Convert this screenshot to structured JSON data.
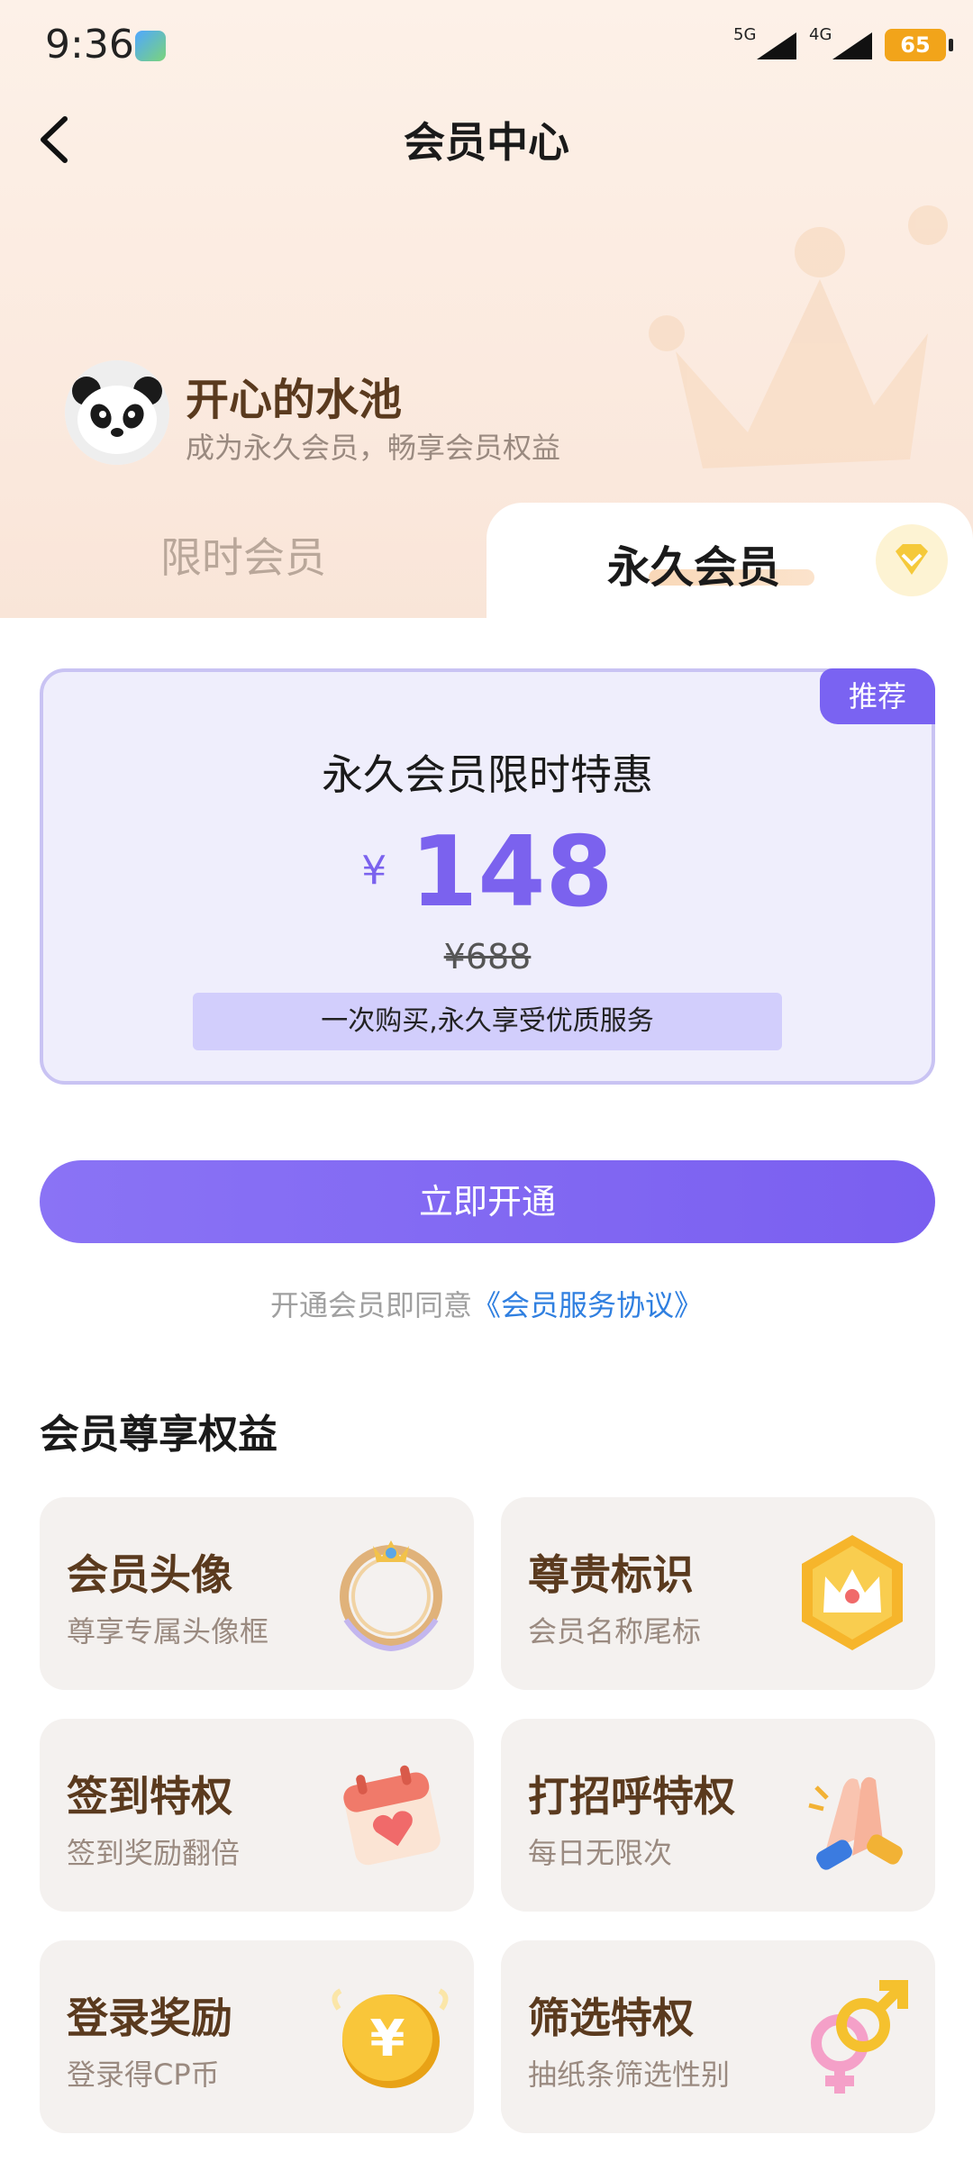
{
  "status_bar": {
    "time": "9:36",
    "signal_1_label": "5G",
    "signal_2_label": "4G",
    "battery": "65"
  },
  "nav": {
    "title": "会员中心",
    "back_icon": "chevron-left-icon"
  },
  "profile": {
    "username": "开心的水池",
    "subtitle": "成为永久会员，畅享会员权益",
    "avatar_icon": "panda-avatar"
  },
  "tabs": [
    {
      "label": "限时会员",
      "selected": false
    },
    {
      "label": "永久会员",
      "selected": true
    }
  ],
  "offer": {
    "badge": "推荐",
    "title": "永久会员限时特惠",
    "currency": "¥",
    "price": "148",
    "original_price": "¥688",
    "note": "一次购买,永久享受优质服务"
  },
  "cta": {
    "label": "立即开通"
  },
  "agreement": {
    "prefix": "开通会员即同意",
    "link": "《会员服务协议》"
  },
  "benefits": {
    "title": "会员尊享权益",
    "items": [
      {
        "name": "会员头像",
        "desc": "尊享专属头像框",
        "icon": "avatar-frame-icon"
      },
      {
        "name": "尊贵标识",
        "desc": "会员名称尾标",
        "icon": "crown-badge-icon"
      },
      {
        "name": "签到特权",
        "desc": "签到奖励翻倍",
        "icon": "calendar-heart-icon"
      },
      {
        "name": "打招呼特权",
        "desc": "每日无限次",
        "icon": "clapping-hands-icon"
      },
      {
        "name": "登录奖励",
        "desc": "登录得CP币",
        "icon": "yuan-coin-icon"
      },
      {
        "name": "筛选特权",
        "desc": "抽纸条筛选性别",
        "icon": "gender-symbols-icon"
      }
    ]
  },
  "colors": {
    "accent": "#7a63f2",
    "link": "#2f7fe0",
    "brown_text": "#5a3a1e",
    "top_bg": "#fbeadf"
  }
}
